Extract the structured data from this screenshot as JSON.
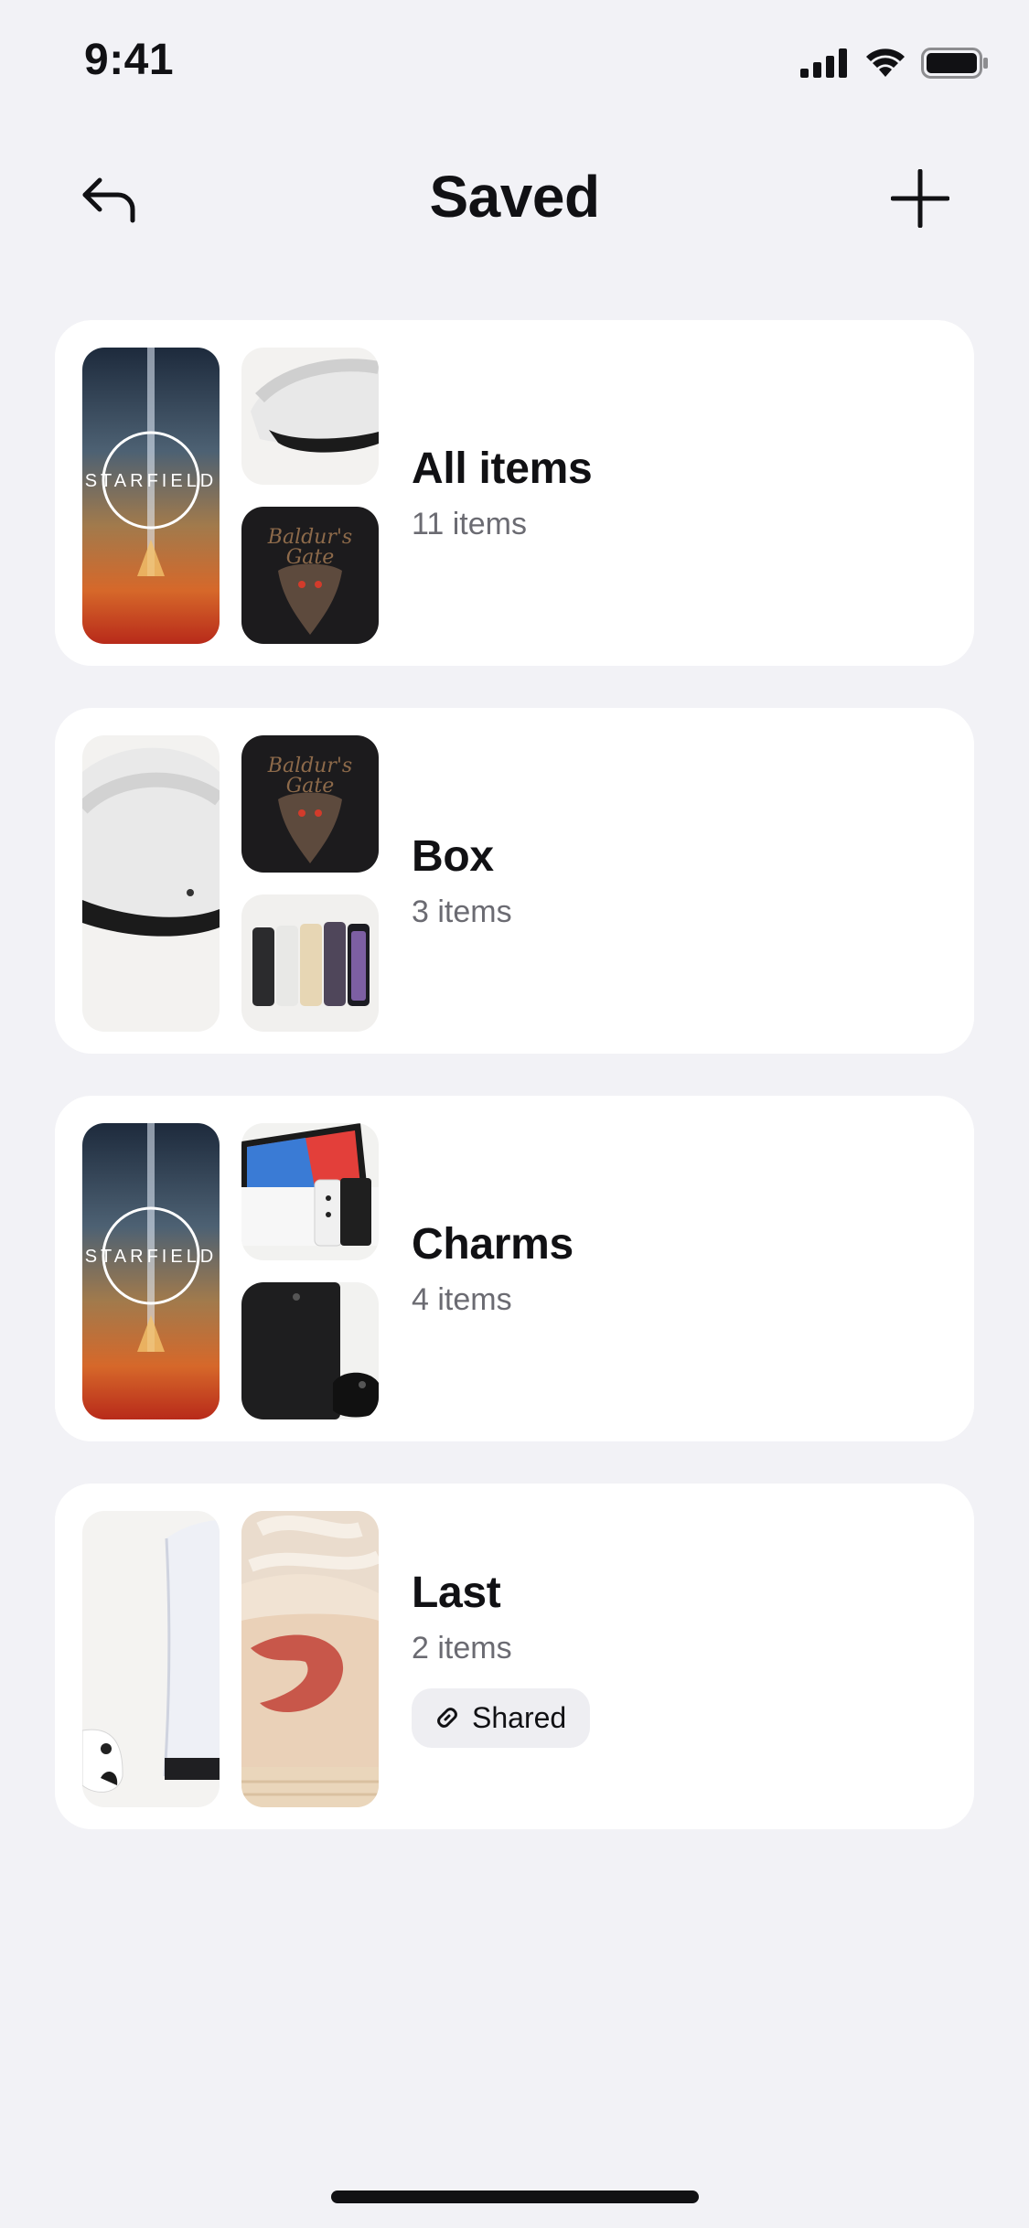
{
  "status_bar": {
    "time": "9:41",
    "icons": [
      "signal-icon",
      "wifi-icon",
      "battery-icon"
    ]
  },
  "nav": {
    "title": "Saved",
    "back_icon": "undo-arrow-icon",
    "add_icon": "plus-icon"
  },
  "collections": [
    {
      "title": "All items",
      "count": "11 items",
      "thumbnails": [
        "starfield-cover",
        "vr-headset",
        "baldurs-gate-cover"
      ],
      "shared": false
    },
    {
      "title": "Box",
      "count": "3 items",
      "thumbnails": [
        "vr-headset",
        "baldurs-gate-cover",
        "iphone-lineup"
      ],
      "shared": false
    },
    {
      "title": "Charms",
      "count": "4 items",
      "thumbnails": [
        "starfield-cover",
        "nintendo-switch",
        "xbox-series-x"
      ],
      "shared": false
    },
    {
      "title": "Last",
      "count": "2 items",
      "thumbnails": [
        "ps5-console",
        "sneaker"
      ],
      "shared": true,
      "shared_label": "Shared"
    }
  ],
  "colors": {
    "background": "#f2f2f6",
    "card": "#ffffff",
    "text": "#111114",
    "secondary_text": "#6b6b72",
    "badge": "#eeeef2"
  }
}
